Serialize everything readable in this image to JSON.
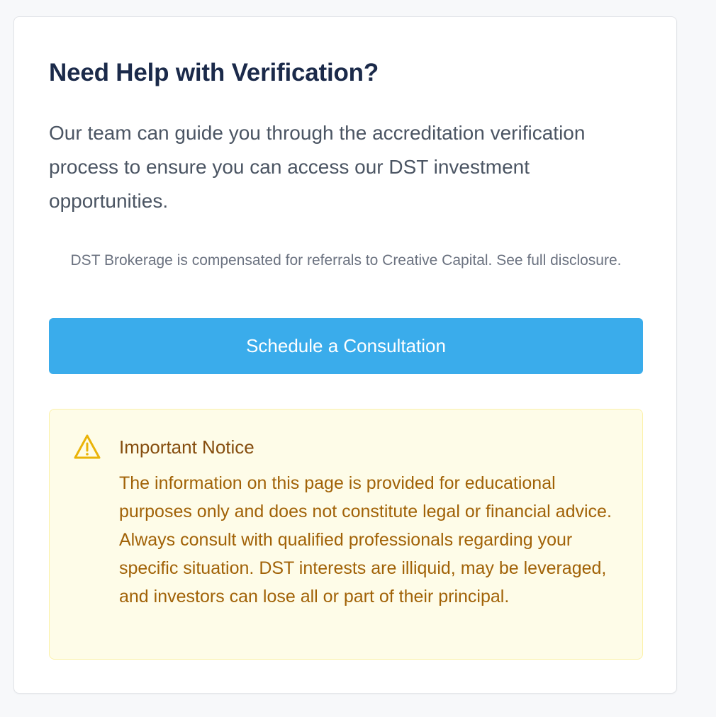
{
  "help_card": {
    "title": "Need Help with Verification?",
    "intro": "Our team can guide you through the accreditation verification process to ensure you can access our DST investment opportunities.",
    "disclosure": "DST Brokerage is compensated for referrals to Creative Capital. See full disclosure.",
    "cta_label": "Schedule a Consultation"
  },
  "notice": {
    "icon": "warning-triangle-icon",
    "title": "Important Notice",
    "body": "The information on this page is provided for educational purposes only and does not constitute legal or financial advice. Always consult with qualified professionals regarding your specific situation. DST interests are illiquid, may be leveraged, and investors can lose all or part of their principal."
  },
  "colors": {
    "accent": "#3aaceb",
    "title": "#1b2a4a",
    "notice_bg": "#fefce8",
    "notice_text": "#a16207",
    "notice_icon": "#eab308"
  }
}
